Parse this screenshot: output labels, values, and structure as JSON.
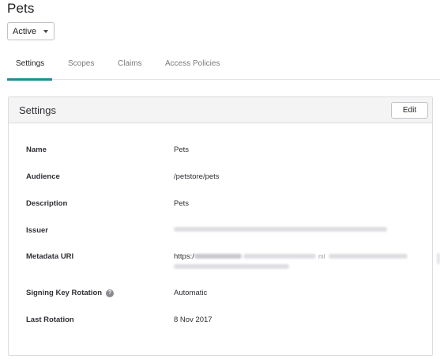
{
  "page": {
    "title": "Pets"
  },
  "status_select": {
    "value": "Active"
  },
  "tabs": [
    {
      "label": "Settings",
      "active": true
    },
    {
      "label": "Scopes",
      "active": false
    },
    {
      "label": "Claims",
      "active": false
    },
    {
      "label": "Access Policies",
      "active": false
    }
  ],
  "panel": {
    "title": "Settings",
    "edit_label": "Edit",
    "rows": {
      "name": {
        "label": "Name",
        "value": "Pets"
      },
      "audience": {
        "label": "Audience",
        "value": "/petstore/pets"
      },
      "description": {
        "label": "Description",
        "value": "Pets"
      },
      "issuer": {
        "label": "Issuer",
        "value": ""
      },
      "metadata_uri": {
        "label": "Metadata URI",
        "value_prefix": "https:/",
        "value_fragment": "ml"
      },
      "signing_key_rotation": {
        "label": "Signing Key Rotation",
        "value": "Automatic"
      },
      "last_rotation": {
        "label": "Last Rotation",
        "value": "8 Nov 2017"
      }
    }
  },
  "colors": {
    "accent": "#1d8f93",
    "panel_header_bg": "#f4f4f5",
    "border": "#dcdce0"
  },
  "icons": {
    "status_caret": "chevron-down-icon",
    "signing_help": "help-icon"
  }
}
